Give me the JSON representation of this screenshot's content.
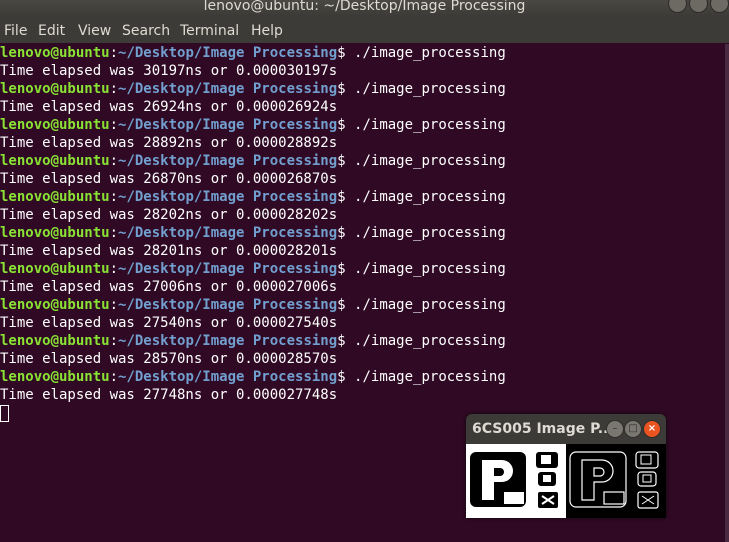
{
  "window": {
    "title": "lenovo@ubuntu: ~/Desktop/Image Processing"
  },
  "menu": {
    "items": [
      "File",
      "Edit",
      "View",
      "Search",
      "Terminal",
      "Help"
    ]
  },
  "terminal": {
    "prompt_user": "lenovo@ubuntu",
    "prompt_sep": ":",
    "prompt_path": "~/Desktop/Image Processing",
    "prompt_end": "$ ",
    "command": "./image_processing",
    "outputs": [
      "Time elapsed was 30197ns or 0.000030197s",
      "Time elapsed was 26924ns or 0.000026924s",
      "Time elapsed was 28892ns or 0.000028892s",
      "Time elapsed was 26870ns or 0.000026870s",
      "Time elapsed was 28202ns or 0.000028202s",
      "Time elapsed was 28201ns or 0.000028201s",
      "Time elapsed was 27006ns or 0.000027006s",
      "Time elapsed was 27540ns or 0.000027540s",
      "Time elapsed was 28570ns or 0.000028570s",
      "Time elapsed was 27748ns or 0.000027748s"
    ]
  },
  "popup": {
    "title": "6CS005 Image P..."
  },
  "colors": {
    "background": "#300a24",
    "prompt_user": "#8ae234",
    "prompt_path": "#729fcf",
    "close_button": "#e95420"
  }
}
